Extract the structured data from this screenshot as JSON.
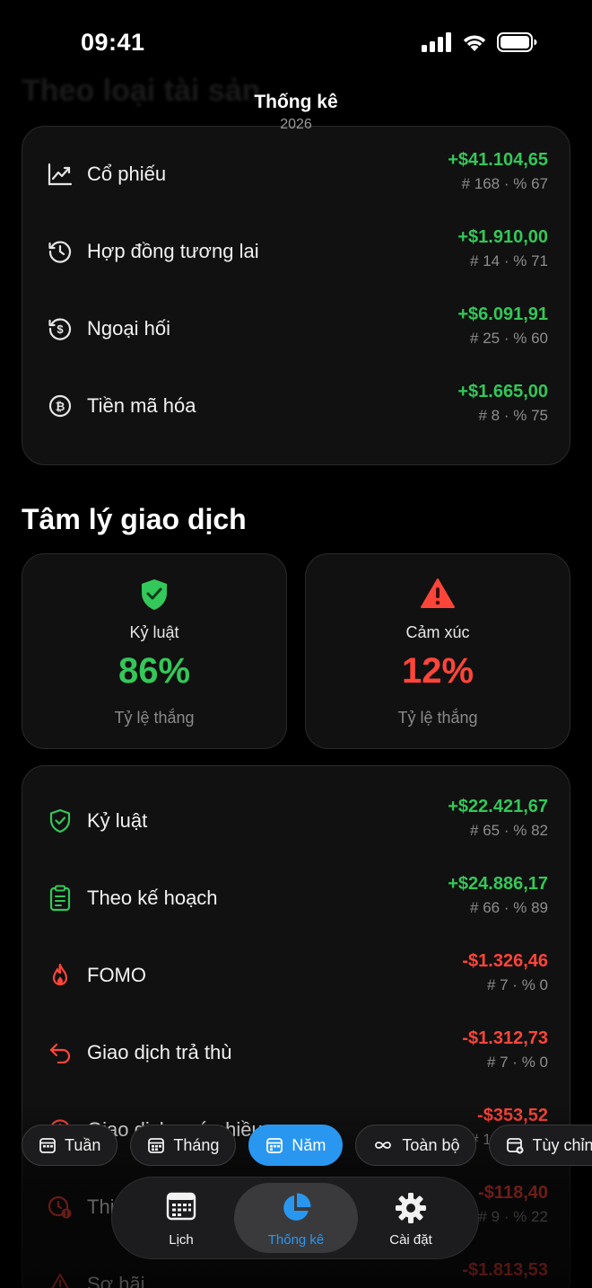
{
  "status_bar": {
    "time": "09:41"
  },
  "background_heading": "Theo loại tài sản",
  "nav": {
    "title": "Thống kê",
    "subtitle": "2026"
  },
  "asset_types": [
    {
      "icon": "stock-chart-icon",
      "label": "Cổ phiếu",
      "amount": "+$41.104,65",
      "meta": "# 168 · % 67",
      "tone": "pos"
    },
    {
      "icon": "clock-history-icon",
      "label": "Hợp đồng tương lai",
      "amount": "+$1.910,00",
      "meta": "# 14 · % 71",
      "tone": "pos"
    },
    {
      "icon": "dollar-cycle-icon",
      "label": "Ngoại hối",
      "amount": "+$6.091,91",
      "meta": "# 25 · % 60",
      "tone": "pos"
    },
    {
      "icon": "bitcoin-icon",
      "label": "Tiền mã hóa",
      "amount": "+$1.665,00",
      "meta": "# 8 · % 75",
      "tone": "pos"
    }
  ],
  "psychology": {
    "title": "Tâm lý giao dịch",
    "discipline": {
      "title": "Kỷ luật",
      "value": "86%",
      "sub": "Tỷ lệ thắng",
      "color": "#34c759"
    },
    "emotion": {
      "title": "Cảm xúc",
      "value": "12%",
      "sub": "Tỷ lệ thắng",
      "color": "#ff453a"
    }
  },
  "psych_rows": [
    {
      "icon": "shield-check-icon",
      "label": "Kỷ luật",
      "amount": "+$22.421,67",
      "meta": "# 65 · % 82",
      "tone": "pos"
    },
    {
      "icon": "clipboard-icon",
      "label": "Theo kế hoạch",
      "amount": "+$24.886,17",
      "meta": "# 66 · % 89",
      "tone": "pos"
    },
    {
      "icon": "flame-icon",
      "label": "FOMO",
      "amount": "-$1.326,46",
      "meta": "# 7 · % 0",
      "tone": "neg"
    },
    {
      "icon": "undo-arrow-icon",
      "label": "Giao dịch trả thù",
      "amount": "-$1.312,73",
      "meta": "# 7 · % 0",
      "tone": "neg"
    },
    {
      "icon": "warning-circle-icon",
      "label": "Giao dịch quá nhiều",
      "amount": "-$353,52",
      "meta": "# 10 · % 10",
      "tone": "neg"
    },
    {
      "icon": "clock-alert-icon",
      "label": "Thiếu kiên nhẫn",
      "amount": "-$118,40",
      "meta": "# 9 · % 22",
      "tone": "neg"
    },
    {
      "icon": "triangle-alert-icon",
      "label": "Sợ hãi",
      "amount": "-$1.813,53",
      "meta": "",
      "tone": "neg"
    }
  ],
  "period_chips": [
    {
      "label": "Tuần",
      "active": false
    },
    {
      "label": "Tháng",
      "active": false
    },
    {
      "label": "Năm",
      "active": true
    },
    {
      "label": "Toàn bộ",
      "active": false
    },
    {
      "label": "Tùy chỉnh",
      "active": false
    }
  ],
  "tabs": [
    {
      "label": "Lịch",
      "icon": "calendar-icon",
      "active": false
    },
    {
      "label": "Thống kê",
      "icon": "pie-chart-icon",
      "active": true
    },
    {
      "label": "Cài đặt",
      "icon": "gear-icon",
      "active": false
    }
  ],
  "colors": {
    "positive": "#34c759",
    "negative": "#ff453a",
    "accent": "#2997f0",
    "card": "#111111"
  }
}
